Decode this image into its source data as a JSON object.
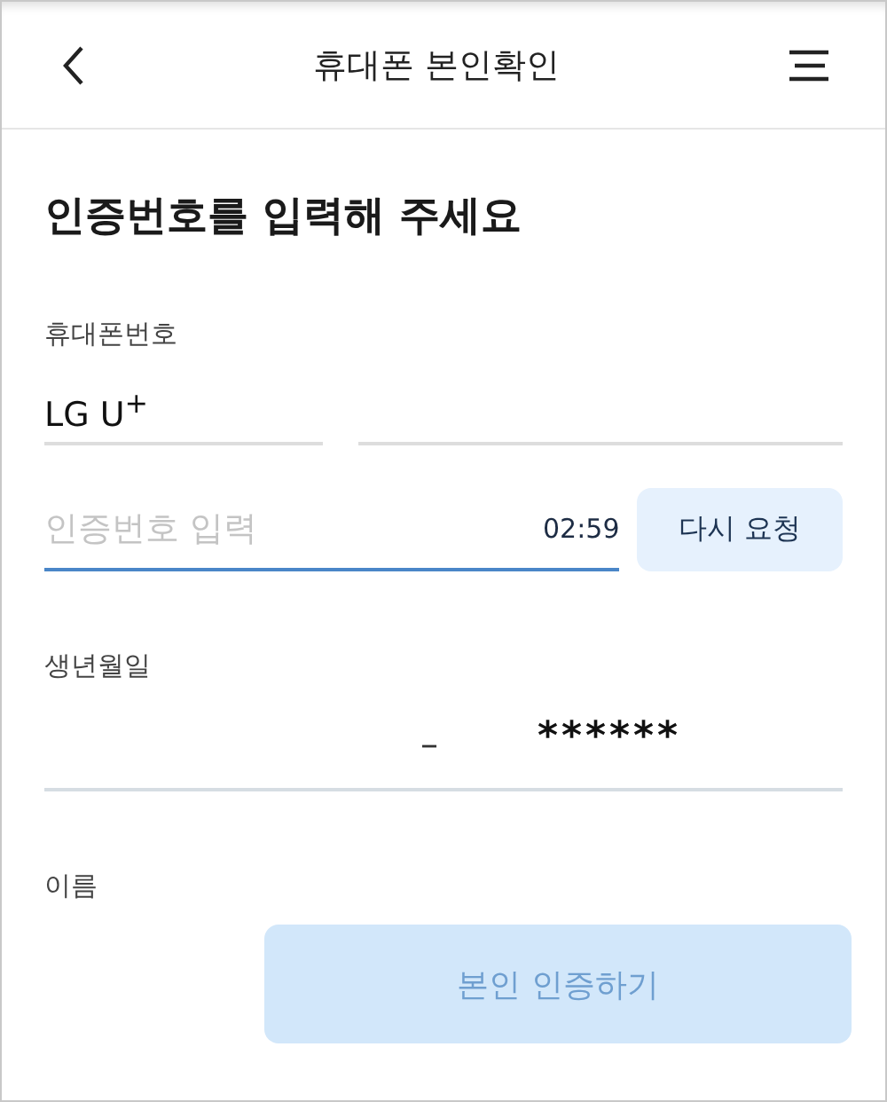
{
  "header": {
    "title": "휴대폰 본인확인"
  },
  "heading": "인증번호를 입력해 주세요",
  "phone": {
    "label": "휴대폰번호",
    "carrier": "LG U$^{+}$"
  },
  "code": {
    "placeholder": "인증번호 입력",
    "focused": true,
    "timer": "02:59",
    "resend": "다시 요청"
  },
  "birth": {
    "label": "생년월일",
    "separator": "–",
    "masked": "******"
  },
  "name": {
    "label": "이름"
  },
  "submit": {
    "label": "본인 인증하기",
    "disabled": true
  }
}
